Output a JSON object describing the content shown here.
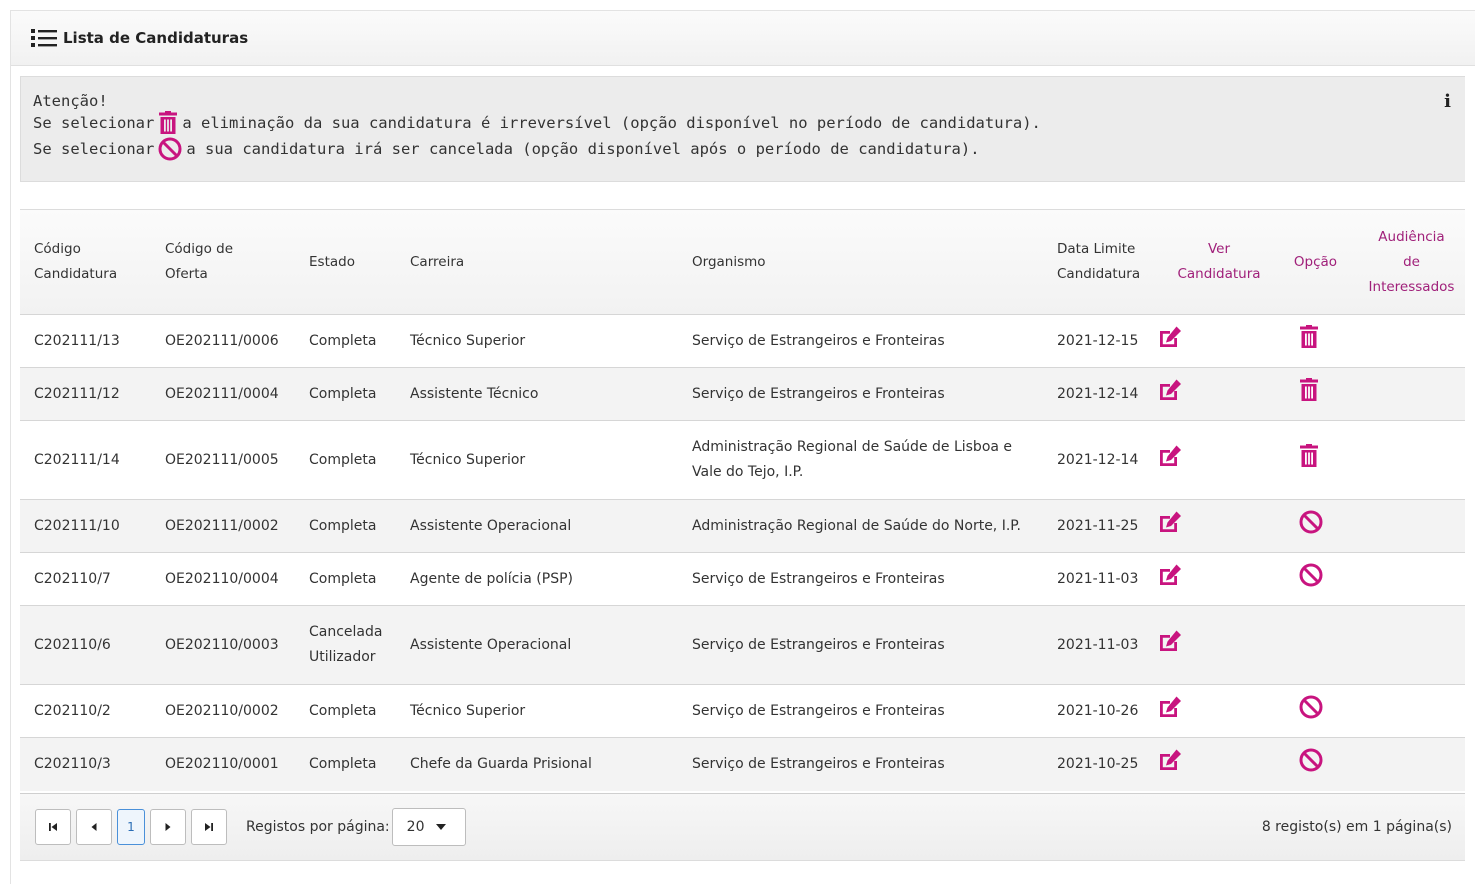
{
  "header": {
    "title": "Lista de Candidaturas",
    "icon": "list-icon"
  },
  "alert": {
    "title": "Atenção!",
    "line1_prefix": "Se selecionar",
    "line1_suffix": "a eliminação da sua candidatura é irreversível (opção disponível no período de candidatura).",
    "line2_prefix": "Se selecionar",
    "line2_suffix": "a sua candidatura irá ser cancelada (opção disponível após o período de candidatura).",
    "info_glyph": "i"
  },
  "colors": {
    "accent": "#c8147f",
    "link": "#a0207a"
  },
  "table": {
    "headers": {
      "codigo_l1": "Código",
      "codigo_l2": "Candidatura",
      "oferta_l1": "Código de",
      "oferta_l2": "Oferta",
      "estado": "Estado",
      "carreira": "Carreira",
      "organismo": "Organismo",
      "data_l1": "Data Limite",
      "data_l2": "Candidatura",
      "ver_l1": "Ver",
      "ver_l2": "Candidatura",
      "opcao": "Opção",
      "aud_l1": "Audiência",
      "aud_l2": "de",
      "aud_l3": "Interessados"
    },
    "rows": [
      {
        "codigo": "C202111/13",
        "oferta": "OE202111/0006",
        "estado": "Completa",
        "estado2": "",
        "carreira": "Técnico Superior",
        "organismo": "Serviço de Estrangeiros e Fronteiras",
        "organismo2": "",
        "data": "2021-12-15",
        "opcao": "trash"
      },
      {
        "codigo": "C202111/12",
        "oferta": "OE202111/0004",
        "estado": "Completa",
        "estado2": "",
        "carreira": "Assistente Técnico",
        "organismo": "Serviço de Estrangeiros e Fronteiras",
        "organismo2": "",
        "data": "2021-12-14",
        "opcao": "trash"
      },
      {
        "codigo": "C202111/14",
        "oferta": "OE202111/0005",
        "estado": "Completa",
        "estado2": "",
        "carreira": "Técnico Superior",
        "organismo": "Administração Regional de Saúde de Lisboa e",
        "organismo2": "Vale do Tejo, I.P.",
        "data": "2021-12-14",
        "opcao": "trash"
      },
      {
        "codigo": "C202111/10",
        "oferta": "OE202111/0002",
        "estado": "Completa",
        "estado2": "",
        "carreira": "Assistente Operacional",
        "organismo": "Administração Regional de Saúde do Norte, I.P.",
        "organismo2": "",
        "data": "2021-11-25",
        "opcao": "ban"
      },
      {
        "codigo": "C202110/7",
        "oferta": "OE202110/0004",
        "estado": "Completa",
        "estado2": "",
        "carreira": "Agente de polícia (PSP)",
        "organismo": "Serviço de Estrangeiros e Fronteiras",
        "organismo2": "",
        "data": "2021-11-03",
        "opcao": "ban"
      },
      {
        "codigo": "C202110/6",
        "oferta": "OE202110/0003",
        "estado": "Cancelada",
        "estado2": "Utilizador",
        "carreira": "Assistente Operacional",
        "organismo": "Serviço de Estrangeiros e Fronteiras",
        "organismo2": "",
        "data": "2021-11-03",
        "opcao": ""
      },
      {
        "codigo": "C202110/2",
        "oferta": "OE202110/0002",
        "estado": "Completa",
        "estado2": "",
        "carreira": "Técnico Superior",
        "organismo": "Serviço de Estrangeiros e Fronteiras",
        "organismo2": "",
        "data": "2021-10-26",
        "opcao": "ban"
      },
      {
        "codigo": "C202110/3",
        "oferta": "OE202110/0001",
        "estado": "Completa",
        "estado2": "",
        "carreira": "Chefe da Guarda Prisional",
        "organismo": "Serviço de Estrangeiros e Fronteiras",
        "organismo2": "",
        "data": "2021-10-25",
        "opcao": "ban"
      }
    ]
  },
  "pager": {
    "current_page": "1",
    "per_page_label": "Registos por página:",
    "per_page_value": "20",
    "info": "8 registo(s) em 1 página(s)"
  }
}
